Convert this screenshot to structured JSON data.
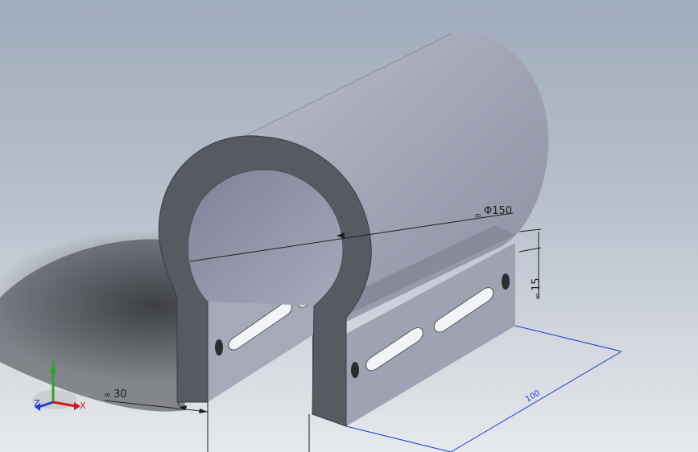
{
  "viewport": {
    "background_top": "#a0abbb",
    "background_bottom": "#e6e9ec"
  },
  "model": {
    "face_dark": "#565a63",
    "face_light": "#c3c6d3",
    "slot_fill": "#f3f4f7"
  },
  "dimensions": {
    "diameter": {
      "icon": "ꝏ",
      "value": "Φ150"
    },
    "height": {
      "icon": "ꝏ",
      "value": "15"
    },
    "width": {
      "icon": "ꝏ",
      "value": "30"
    },
    "length": {
      "value": "100"
    }
  },
  "triad": {
    "x_label": "X",
    "y_label": "Y",
    "z_label": "Z",
    "x_color": "#d11a1a",
    "y_color": "#2aa52a",
    "z_color": "#1a3fd1"
  }
}
